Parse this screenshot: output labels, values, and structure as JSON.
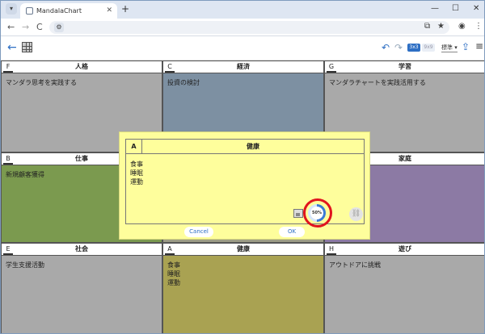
{
  "browser": {
    "tab_title": "MandalaChart",
    "new_tab": "+",
    "minimize": "—",
    "maximize": "☐",
    "close": "✕",
    "tab_close": "✕",
    "back": "←",
    "forward": "→",
    "reload": "C"
  },
  "toolbar": {
    "grid_3x3": "3x3",
    "grid_9x9": "9x9",
    "zoom_value": "標準 ▾"
  },
  "cells": [
    {
      "letter": "F",
      "title": "人格",
      "text": "マンダラ思考を実践する",
      "color": "#a9a9a9"
    },
    {
      "letter": "C",
      "title": "経済",
      "text": "投資の検討",
      "color": "#7d90a2"
    },
    {
      "letter": "G",
      "title": "学習",
      "text": "マンダラチャートを実践活用する",
      "color": "#a9a9a9"
    },
    {
      "letter": "B",
      "title": "仕事",
      "text": "新規顧客獲得",
      "color": "#7b9a4f"
    },
    {
      "letter": "D",
      "title": "家庭",
      "text": "",
      "color": "#8c7aa4"
    },
    {
      "letter": "E",
      "title": "社会",
      "text": "学生支援活動",
      "color": "#a9a9a9"
    },
    {
      "letter": "A",
      "title": "健康",
      "text": "食事\n睡眠\n運動",
      "color": "#a9a252"
    },
    {
      "letter": "H",
      "title": "遊び",
      "text": "アウトドアに挑戦",
      "color": "#a9a9a9"
    }
  ],
  "dialog": {
    "letter": "A",
    "title": "健康",
    "text": "食事\n睡眠\n運動",
    "progress_label": "50%",
    "progress_value": 0.5,
    "cancel_label": "Cancel",
    "ok_label": "OK",
    "bg_color": "#fefe9c"
  },
  "icons": [
    "back-arrow-icon",
    "grid-icon",
    "undo-icon",
    "redo-icon",
    "share-icon",
    "menu-icon",
    "image-icon",
    "link-icon"
  ]
}
